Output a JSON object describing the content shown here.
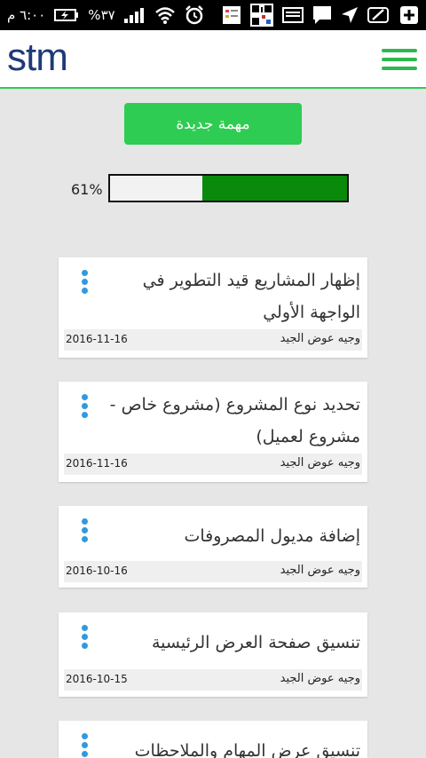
{
  "status_bar": {
    "time": "٦:٠٠ م",
    "battery_percent": "%٣٧",
    "icons": [
      "alarm-icon",
      "wifi-icon",
      "signal-icon",
      "battery-charging-icon",
      "notes-icon",
      "qr-icon",
      "image-icon",
      "message-icon",
      "location-icon",
      "edit-icon",
      "add-icon"
    ]
  },
  "app_bar": {
    "logo_text": "stm",
    "menu_icon": "hamburger-menu-icon",
    "accent_color": "#2ecc52"
  },
  "actions": {
    "new_task_label": "مهمة جديدة"
  },
  "progress": {
    "label": "61%",
    "value": 0.61,
    "fill_color": "#0a8a0a"
  },
  "tasks": [
    {
      "title": "إظهار المشاريع قيد التطوير في الواجهة الأولي",
      "author": "وجيه عوض الجيد",
      "date": "2016-11-16"
    },
    {
      "title": "تحديد نوع المشروع (مشروع خاص - مشروع لعميل)",
      "author": "وجيه عوض الجيد",
      "date": "2016-11-16"
    },
    {
      "title": "إضافة مديول المصروفات",
      "author": "وجيه عوض الجيد",
      "date": "2016-10-16"
    },
    {
      "title": "تنسيق صفحة العرض الرئيسية",
      "author": "وجيه عوض الجيد",
      "date": "2016-10-15"
    },
    {
      "title": "تنسيق عرض المهام والملاحظات",
      "author": "",
      "date": ""
    }
  ]
}
